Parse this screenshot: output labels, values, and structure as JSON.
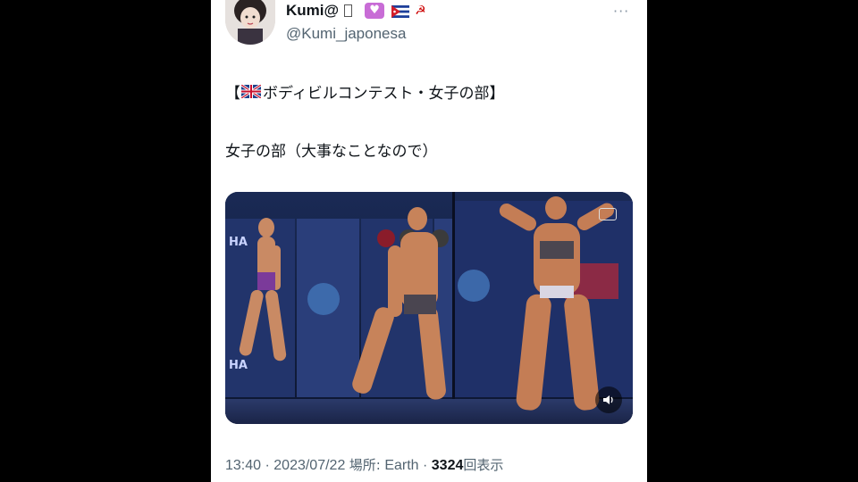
{
  "tweet": {
    "author": {
      "display_name": "Kumi@",
      "handle": "@Kumi_japonesa",
      "badge_icon": "heart-icon",
      "flags": [
        "cuba-flag-icon",
        "hammer-sickle-icon"
      ]
    },
    "more_label": "···",
    "title_text": "ボディビルコンテスト・女子の部",
    "title_open": "【",
    "title_close": "】",
    "title_flag_icon": "uk-flag-icon",
    "body_text": "女子の部（大事なことなので）",
    "media": {
      "type": "video",
      "sound_icon": "speaker-icon",
      "caption_icon": "cc-icon"
    },
    "meta": {
      "time": "13:40",
      "separator": " · ",
      "date": "2023/07/22",
      "location_label": "場所:",
      "location": "Earth",
      "views": "3324",
      "views_label": "回表示"
    }
  },
  "colors": {
    "background": "#000000",
    "card": "#ffffff",
    "text_primary": "#0f1419",
    "text_secondary": "#536471",
    "badge": "#c86cd6",
    "stage": "#111a36"
  }
}
